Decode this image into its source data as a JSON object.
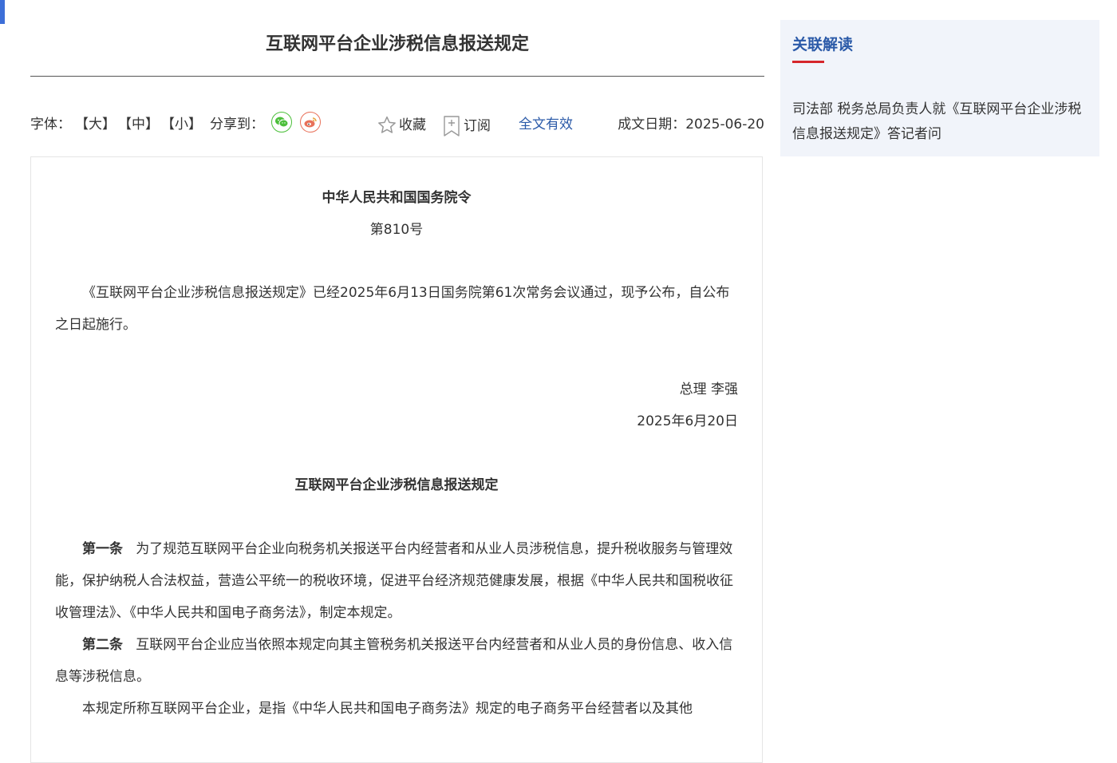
{
  "article": {
    "title": "互联网平台企业涉税信息报送规定"
  },
  "toolbar": {
    "font_size_label": "字体：",
    "font_large": "【大】",
    "font_medium": "【中】",
    "font_small": "【小】",
    "share_label": "分享到：",
    "collect_label": "收藏",
    "subscribe_label": "订阅",
    "validity": "全文有效",
    "date_label": "成文日期：2025-06-20"
  },
  "icons": {
    "share_wechat": "wechat-icon",
    "share_weibo": "weibo-icon",
    "collect": "star-icon",
    "subscribe": "bookmark-plus-icon"
  },
  "colors": {
    "accent_blue": "#2b5aa8",
    "accent_red": "#d6262b",
    "wechat_green": "#4cbf3b",
    "weibo_orange": "#e8715a",
    "sidebar_bg": "#f1f4fa"
  },
  "content": {
    "order_title": "中华人民共和国国务院令",
    "order_number": "第810号",
    "announcement": "《互联网平台企业涉税信息报送规定》已经2025年6月13日国务院第61次常务会议通过，现予公布，自公布之日起施行。",
    "signer": "总理  李强",
    "sign_date": "2025年6月20日",
    "regulation_title": "互联网平台企业涉税信息报送规定",
    "article1_label": "第一条",
    "article1_text": "为了规范互联网平台企业向税务机关报送平台内经营者和从业人员涉税信息，提升税收服务与管理效能，保护纳税人合法权益，营造公平统一的税收环境，促进平台经济规范健康发展，根据《中华人民共和国税收征收管理法》、《中华人民共和国电子商务法》，制定本规定。",
    "article2_label": "第二条",
    "article2_text": "互联网平台企业应当依照本规定向其主管税务机关报送平台内经营者和从业人员的身份信息、收入信息等涉税信息。",
    "article2_p2": "本规定所称互联网平台企业，是指《中华人民共和国电子商务法》规定的电子商务平台经营者以及其他"
  },
  "sidebar": {
    "title": "关联解读",
    "link": "司法部 税务总局负责人就《互联网平台企业涉税信息报送规定》答记者问"
  }
}
